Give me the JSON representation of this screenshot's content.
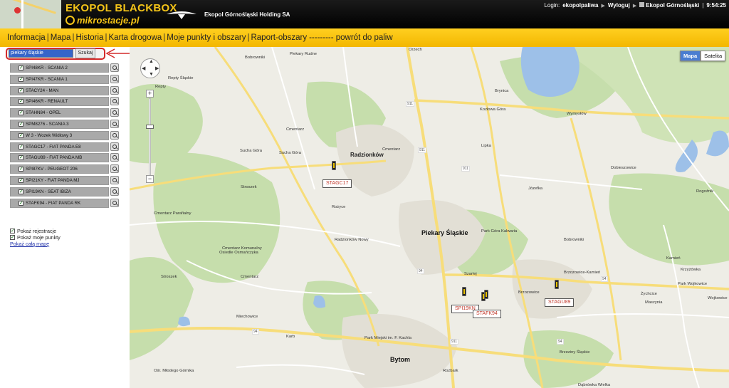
{
  "header": {
    "brand_title": "EKOPOL BLACKBOX",
    "brand_subtitle": "mikrostacje.pl",
    "company_name": "Ekopol Górnośląski Holding SA",
    "login_label": "Login:",
    "login_user": "ekopolpaliwa",
    "logout_label": "Wyloguj",
    "company_link": "Ekopol Górnośląski",
    "time": "9:54:25"
  },
  "nav": {
    "items": [
      "Informacja",
      "Mapa",
      "Historia",
      "Karta drogowa",
      "Moje punkty i obszary",
      "Raport-obszary",
      "--------- powrót do paliw"
    ]
  },
  "search": {
    "value": "piekary śląskie",
    "button_label": "Szukaj"
  },
  "vehicles": [
    "SPI48KR - SCANIA 2",
    "SPI47KR - SCANIA 1",
    "STACY24 - MAN",
    "SPI46KR - RENAULT",
    "STAHN84 - OPEL",
    "SPM8276 - SCANIA 3",
    "W 3 - Wozek Widlowy 3",
    "STAGC17 - FIAT PANDA E8",
    "STAGU89 - FIAT PANDA MB",
    "SPI87KV - PEUGEOT 206",
    "SPI21KY - FIAT PANDA MJ",
    "SPI19KN - SEAT IBIZA",
    "STAFK94 - FIAT PANDA RK"
  ],
  "options": {
    "show_registration": "Pokaż rejestracje",
    "show_my_points": "Pokaż moje punkty",
    "show_whole_map": "Pokaż całą mapę"
  },
  "map": {
    "type_map": "Mapa",
    "type_satellite": "Satelita",
    "places": {
      "orzech": "Orzech",
      "piekary_rudne": "Piekary Rudne",
      "bobrowniki_top": "Bobrowniki",
      "repty_slaskie": "Repty Śląskie",
      "repty": "Repty",
      "wymyslow": "Wymysłów",
      "kozlowa_gora": "Kozłowa Góra",
      "brynica": "Brynica",
      "cmentarz1": "Cmentarz",
      "sucha_gora1": "Sucha Góra",
      "sucha_gora2": "Sucha Góra",
      "radzionkow": "Radzionków",
      "cmentarz2": "Cmentarz",
      "lipka": "Lipka",
      "dobieszowice": "Dobieszowice",
      "stroszek": "Stroszek",
      "rozyce": "Rożyce",
      "rogoznik": "Rogoźnik",
      "sadyc": "Józefka",
      "cmentarz_parafialny": "Cmentarz Parafialny",
      "radzionkow_nowy": "Radzionków Nowy",
      "piekary_slaskie": "Piekary Śląskie",
      "park_gora_kalwaria": "Park Góra Kalwaria",
      "bobrowniki_mid": "Bobrowniki",
      "cmentarz_komunalny": "Cmentarz Komunalny",
      "brzozowice_kamien": "Brzozowice-Kamień",
      "kamien": "Kamień",
      "krzyzowka": "Krzyżówka",
      "szarlej": "Szarlej",
      "brzozowice": "Brzozowice",
      "park_wojkowice": "Park Wojkowice",
      "zychcice": "Żychcice",
      "maszynia": "Maszynia",
      "wojkowice": "Wojkowice",
      "miechowice": "Miechowice",
      "karb": "Karb",
      "bytom": "Bytom",
      "stroszek2": "Stroszek",
      "osiedle": "Osiedle Osmańczyka",
      "cmentarz3": "Cmentarz",
      "brzeziny_slaskie": "Brzeziny Śląskie",
      "rozbark": "Rozbark",
      "dabrowka": "Dąbrówka Wielka",
      "park_miejski": "Park Miejski im. F. Kachla",
      "mlodego": "Ośr. Młodego Górnika"
    },
    "roads": [
      "911",
      "911",
      "911",
      "94",
      "94",
      "911",
      "94",
      "94"
    ],
    "vehicle_labels": {
      "stagc17": "STAGC17",
      "spi19kn": "SPI19KN",
      "stafk94": "STAFK94",
      "stagu89": "STAGU89"
    }
  },
  "colors": {
    "header_bg": "#000000",
    "nav_bg": "#f3b700",
    "brand_yellow": "#f5c518",
    "highlight_red": "#d42a2a",
    "map_water": "#9dc0e8",
    "map_green": "#c6deac"
  }
}
